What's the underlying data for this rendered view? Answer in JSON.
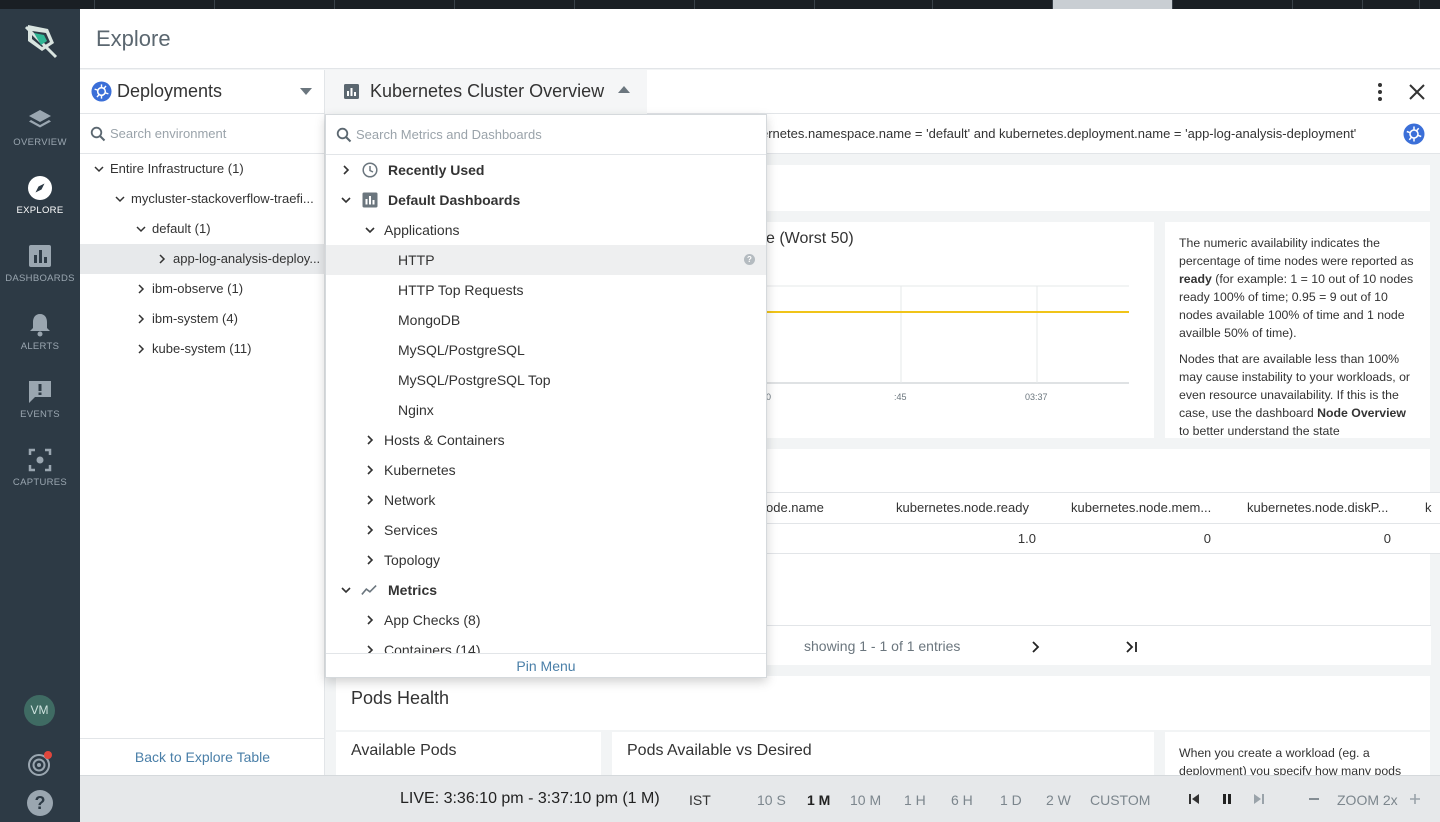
{
  "header": {
    "title": "Explore"
  },
  "nav": {
    "items": [
      {
        "label": "OVERVIEW"
      },
      {
        "label": "EXPLORE"
      },
      {
        "label": "DASHBOARDS"
      },
      {
        "label": "ALERTS"
      },
      {
        "label": "EVENTS"
      },
      {
        "label": "CAPTURES"
      }
    ],
    "avatar": "VM"
  },
  "left_panel": {
    "selector_label": "Deployments",
    "search_placeholder": "Search environment",
    "tree": [
      {
        "label": "Entire Infrastructure (1)"
      },
      {
        "label": "mycluster-stackoverflow-traefi..."
      },
      {
        "label": "default (1)"
      },
      {
        "label": "app-log-analysis-deploy..."
      },
      {
        "label": "ibm-observe (1)"
      },
      {
        "label": "ibm-system (4)"
      },
      {
        "label": "kube-system (11)"
      }
    ],
    "back_link": "Back to Explore Table"
  },
  "dashboard": {
    "title": "Kubernetes Cluster Overview",
    "scope_text": "ernetes.namespace.name = 'default' and kubernetes.deployment.name = 'app-log-analysis-deployment'",
    "chart_title_fragment": "e (Worst 50)",
    "x_ticks": [
      "0",
      ":45",
      "03:37"
    ],
    "description": {
      "p1_pre": "The numeric availability indicates the percentage of time nodes were reported as ",
      "p1_bold": "ready",
      "p1_post": " (for example: 1 = 10 out of 10 nodes ready 100% of time; 0.95 = 9 out of 10 nodes available 100% of time and 1 node availble 50% of time).",
      "p2_pre": "Nodes that are available less than 100% may cause instability to your workloads, or even resource unavailability. If this is the case, use the dashboard ",
      "p2_bold": "Node Overview",
      "p2_post": " to better understand the state"
    },
    "table": {
      "columns": [
        "ode.name",
        "kubernetes.node.ready",
        "kubernetes.node.mem...",
        "kubernetes.node.diskP...",
        "k"
      ],
      "row": [
        "",
        "1.0",
        "0",
        "0"
      ]
    },
    "pager_text": "showing 1 - 1 of 1 entries",
    "pods_health_title": "Pods Health",
    "available_pods_title": "Available Pods",
    "pods_vs_desired_title": "Pods Available vs Desired",
    "pods_desc": "When you create a workload (eg. a deployment) you specify how many pods"
  },
  "dropdown": {
    "search_placeholder": "Search Metrics and Dashboards",
    "items": [
      {
        "label": "Recently Used"
      },
      {
        "label": "Default Dashboards"
      },
      {
        "label": "Applications"
      },
      {
        "label": "HTTP"
      },
      {
        "label": "HTTP Top Requests"
      },
      {
        "label": "MongoDB"
      },
      {
        "label": "MySQL/PostgreSQL"
      },
      {
        "label": "MySQL/PostgreSQL Top"
      },
      {
        "label": "Nginx"
      },
      {
        "label": "Hosts & Containers"
      },
      {
        "label": "Kubernetes"
      },
      {
        "label": "Network"
      },
      {
        "label": "Services"
      },
      {
        "label": "Topology"
      },
      {
        "label": "Metrics"
      },
      {
        "label": "App Checks (8)"
      },
      {
        "label": "Containers (14)"
      }
    ],
    "pin_label": "Pin Menu"
  },
  "timebar": {
    "live": "LIVE: 3:36:10 pm - 3:37:10 pm (1 M)",
    "timezone": "IST",
    "ranges": [
      "10 S",
      "1 M",
      "10 M",
      "1 H",
      "6 H",
      "1 D",
      "2 W",
      "CUSTOM"
    ],
    "selected_range": "1 M",
    "zoom": "ZOOM 2x"
  },
  "colors": {
    "nav_bg": "#2d3a45",
    "accent_blue": "#2f6fd6",
    "chart_line": "#f0c419",
    "link": "#4a7fa8"
  }
}
